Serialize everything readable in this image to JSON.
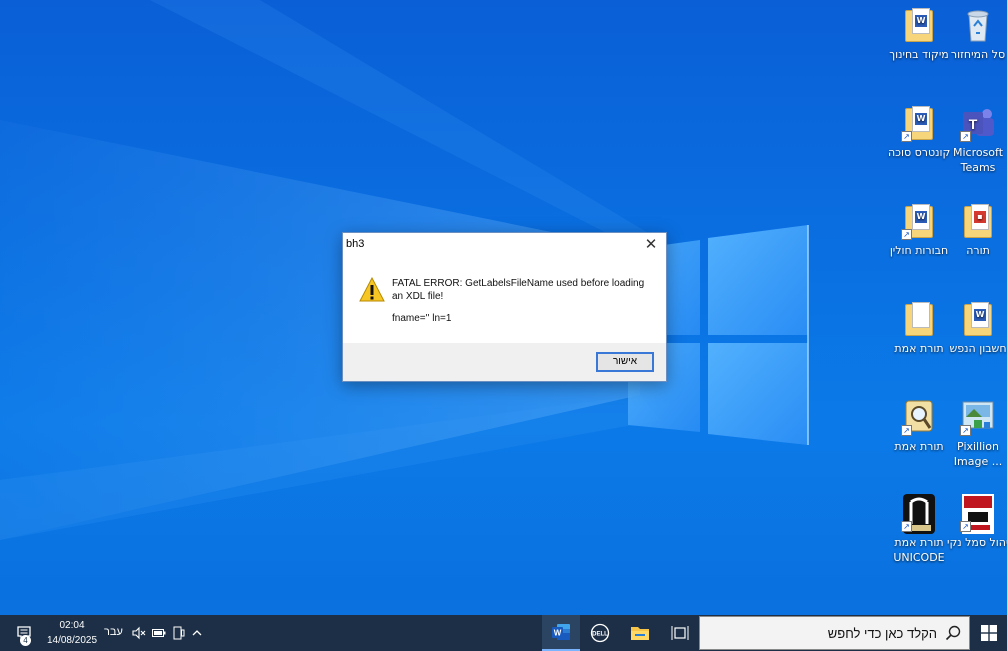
{
  "desktop_icons": [
    {
      "label": "סל המיחזור",
      "label2": "",
      "icon": "recycle-bin-icon"
    },
    {
      "label": "מיקוד בחינוך",
      "label2": "",
      "icon": "word-document-icon"
    },
    {
      "label": "Microsoft",
      "label2": "Teams",
      "icon": "teams-icon"
    },
    {
      "label": "קונטרס סוכה",
      "label2": "",
      "icon": "folder-shortcut-icon"
    },
    {
      "label": "תורה",
      "label2": "",
      "icon": "folder-pdf-icon"
    },
    {
      "label": "חבורות חולין",
      "label2": "",
      "icon": "folder-shortcut-icon"
    },
    {
      "label": "חשבון הנפש",
      "label2": "",
      "icon": "folder-word-icon"
    },
    {
      "label": "תורת אמת",
      "label2": "",
      "icon": "folder-icon"
    },
    {
      "label": "Pixillion",
      "label2": "Image ...",
      "icon": "pixillion-icon"
    },
    {
      "label": "תורת אמת",
      "label2": "",
      "icon": "scroll-magnifier-icon"
    },
    {
      "label": "ניהול סמל נקי",
      "label2": "",
      "icon": "naki-logo-icon"
    },
    {
      "label": "תורת אמת",
      "label2": "UNICODE",
      "icon": "unicode-app-icon"
    }
  ],
  "dialog": {
    "title": "bh3",
    "message": "FATAL ERROR: GetLabelsFileName used before loading an XDL file!",
    "detail": "fname='' ln=1",
    "ok_label": "אישור"
  },
  "taskbar": {
    "search_placeholder": "הקלד כאן כדי לחפש",
    "time": "02:04",
    "date": "14/08/2025",
    "language": "עבר",
    "notification_count": "4"
  }
}
